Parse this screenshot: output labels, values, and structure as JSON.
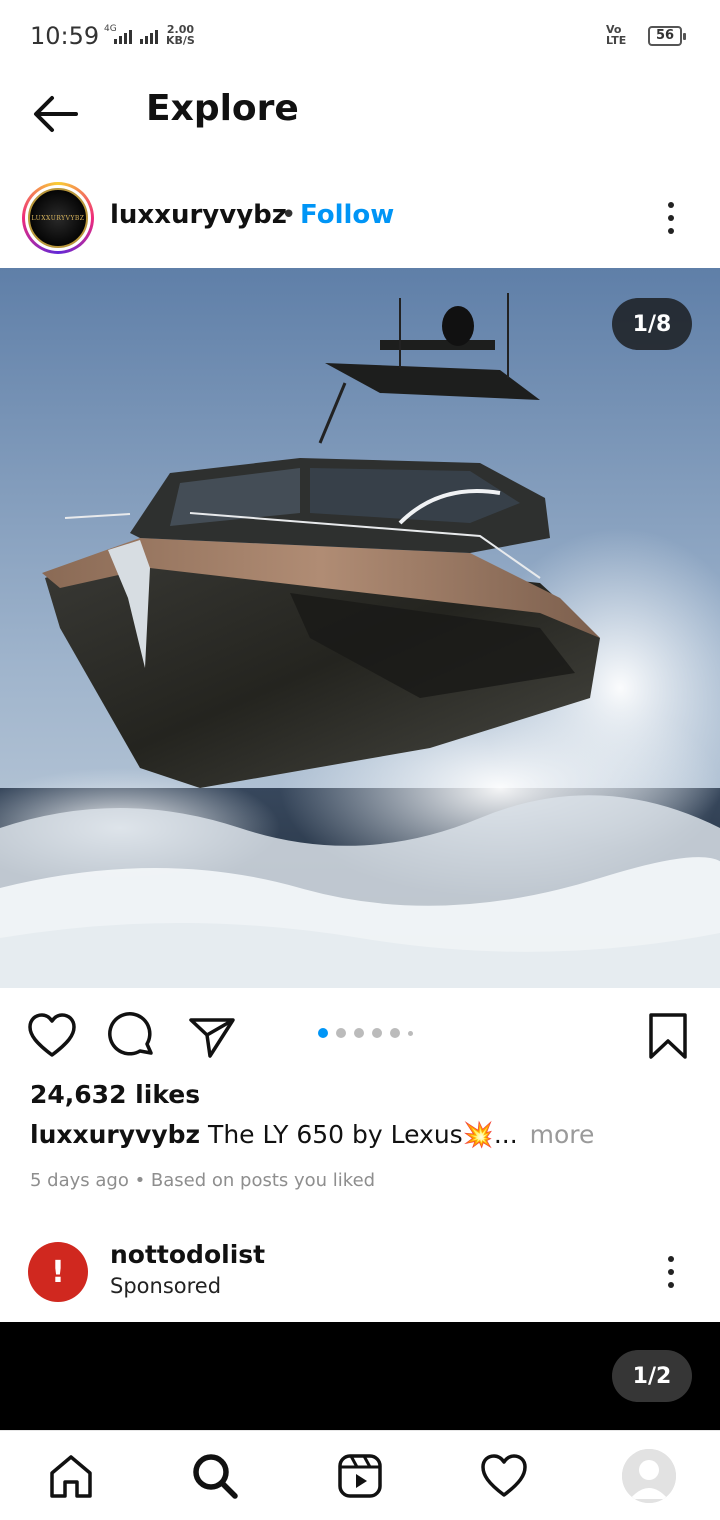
{
  "status_bar": {
    "time": "10:59",
    "network": "4G",
    "rate_value": "2.00",
    "rate_unit": "KB/S",
    "volte_top": "Vo",
    "volte_bottom": "LTE",
    "battery": "56"
  },
  "header": {
    "title": "Explore",
    "back_icon": "arrow-left-icon"
  },
  "post": {
    "username": "luxxuryvybz",
    "separator": "•",
    "follow_label": "Follow",
    "avatar_text": "LUXXURYVYBZ",
    "image_counter": "1/8",
    "carousel_count": 8,
    "carousel_active_index": 0,
    "likes": "24,632 likes",
    "caption_user": "luxxuryvybz",
    "caption_text": "The LY 650 by Lexus💥...",
    "caption_more": "more",
    "timestamp": "5 days ago • Based on posts you liked"
  },
  "sponsored": {
    "username": "nottodolist",
    "label": "Sponsored",
    "avatar_glyph": "!",
    "image_counter": "1/2"
  },
  "bottom_nav": {
    "items": [
      "home-icon",
      "search-icon",
      "reels-icon",
      "activity-heart-icon",
      "profile-avatar"
    ]
  },
  "colors": {
    "follow": "#0095f6",
    "carousel_active": "#0095f6",
    "sponsored_avatar": "#d0281f"
  }
}
